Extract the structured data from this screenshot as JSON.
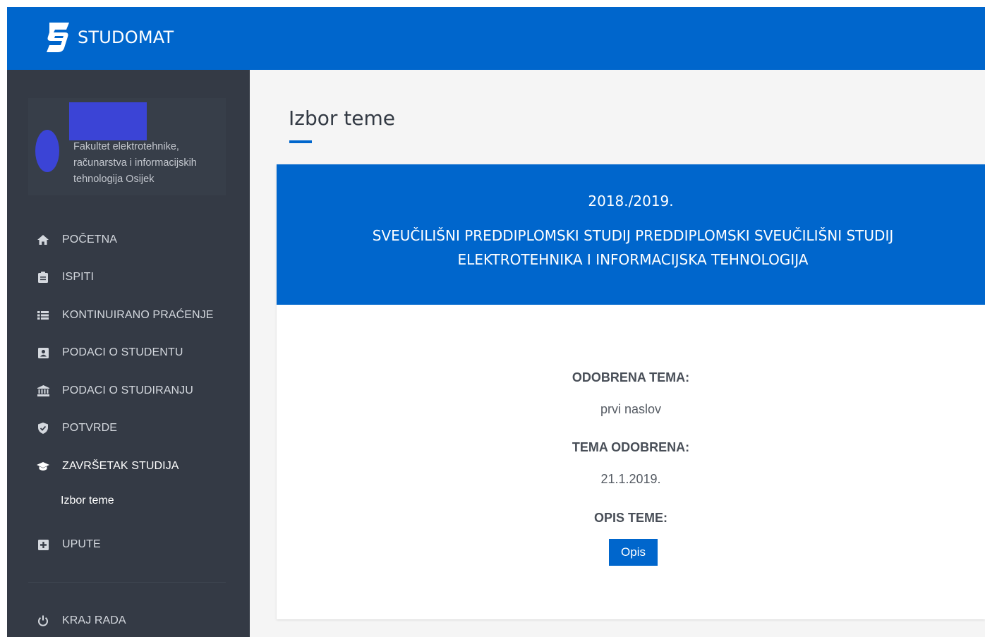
{
  "header": {
    "brand": "STUDOMAT",
    "accent_color": "#0066cc"
  },
  "sidebar": {
    "faculty": "Fakultet elektrotehnike, računarstva i informacijskih tehnologija Osijek",
    "items": [
      {
        "label": "POČETNA",
        "icon": "home-icon"
      },
      {
        "label": "ISPITI",
        "icon": "clipboard-icon"
      },
      {
        "label": "KONTINUIRANO PRAĆENJE",
        "icon": "list-icon"
      },
      {
        "label": "PODACI O STUDENTU",
        "icon": "id-card-icon"
      },
      {
        "label": "PODACI O STUDIRANJU",
        "icon": "university-icon"
      },
      {
        "label": "POTVRDE",
        "icon": "shield-icon"
      },
      {
        "label": "ZAVRŠETAK STUDIJA",
        "icon": "graduation-cap-icon"
      },
      {
        "label": "UPUTE",
        "icon": "plus-square-icon"
      }
    ],
    "subitem": "Izbor teme",
    "logout": {
      "label": "KRAJ RADA",
      "icon": "power-icon"
    },
    "bg_color": "#343a45"
  },
  "main": {
    "title": "Izbor teme",
    "card": {
      "year": "2018./2019.",
      "program": "SVEUČILIŠNI PREDDIPLOMSKI STUDIJ PREDDIPLOMSKI SVEUČILIŠNI STUDIJ ELEKTROTEHNIKA I INFORMACIJSKA TEHNOLOGIJA",
      "approved_topic_label": "ODOBRENA TEMA:",
      "approved_topic_value": "prvi naslov",
      "approved_date_label": "TEMA ODOBRENA:",
      "approved_date_value": "21.1.2019.",
      "description_label": "OPIS TEME:",
      "description_button": "Opis"
    }
  }
}
